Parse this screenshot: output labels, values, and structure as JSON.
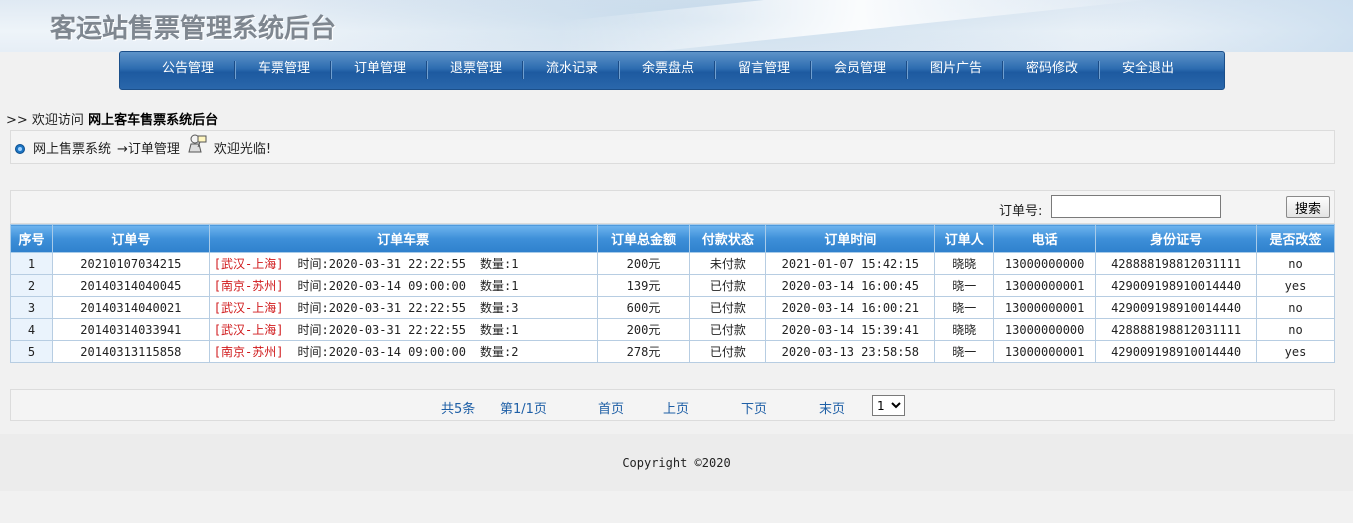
{
  "header": {
    "title": "客运站售票管理系统后台"
  },
  "nav": {
    "items": [
      {
        "label": "公告管理"
      },
      {
        "label": "车票管理"
      },
      {
        "label": "订单管理"
      },
      {
        "label": "退票管理"
      },
      {
        "label": "流水记录"
      },
      {
        "label": "余票盘点"
      },
      {
        "label": "留言管理"
      },
      {
        "label": "会员管理"
      },
      {
        "label": "图片广告"
      },
      {
        "label": "密码修改"
      },
      {
        "label": "安全退出"
      }
    ]
  },
  "welcome": {
    "prefix": ">>  欢迎访问",
    "site": "网上客车售票系统后台"
  },
  "breadcrumb": {
    "root": "网上售票系统",
    "current": "→订单管理",
    "greeting": "欢迎光临!"
  },
  "search": {
    "label": "订单号:",
    "value": "",
    "button": "搜索"
  },
  "table": {
    "headers": [
      "序号",
      "订单号",
      "订单车票",
      "订单总金额",
      "付款状态",
      "订单时间",
      "订单人",
      "电话",
      "身份证号",
      "是否改签"
    ],
    "rows": [
      {
        "idx": "1",
        "order_no": "20210107034215",
        "route": "[武汉-上海]",
        "time": "时间:2020-03-31 22:22:55",
        "qty": "数量:1",
        "amount": "200元",
        "status": "未付款",
        "order_time": "2021-01-07 15:42:15",
        "person": "晓晓",
        "phone": "13000000000",
        "id_no": "428888198812031111",
        "changed": "no"
      },
      {
        "idx": "2",
        "order_no": "20140314040045",
        "route": "[南京-苏州]",
        "time": "时间:2020-03-14 09:00:00",
        "qty": "数量:1",
        "amount": "139元",
        "status": "已付款",
        "order_time": "2020-03-14 16:00:45",
        "person": "晓一",
        "phone": "13000000001",
        "id_no": "429009198910014440",
        "changed": "yes"
      },
      {
        "idx": "3",
        "order_no": "20140314040021",
        "route": "[武汉-上海]",
        "time": "时间:2020-03-31 22:22:55",
        "qty": "数量:3",
        "amount": "600元",
        "status": "已付款",
        "order_time": "2020-03-14 16:00:21",
        "person": "晓一",
        "phone": "13000000001",
        "id_no": "429009198910014440",
        "changed": "no"
      },
      {
        "idx": "4",
        "order_no": "20140314033941",
        "route": "[武汉-上海]",
        "time": "时间:2020-03-31 22:22:55",
        "qty": "数量:1",
        "amount": "200元",
        "status": "已付款",
        "order_time": "2020-03-14 15:39:41",
        "person": "晓晓",
        "phone": "13000000000",
        "id_no": "428888198812031111",
        "changed": "no"
      },
      {
        "idx": "5",
        "order_no": "20140313115858",
        "route": "[南京-苏州]",
        "time": "时间:2020-03-14 09:00:00",
        "qty": "数量:2",
        "amount": "278元",
        "status": "已付款",
        "order_time": "2020-03-13 23:58:58",
        "person": "晓一",
        "phone": "13000000001",
        "id_no": "429009198910014440",
        "changed": "yes"
      }
    ]
  },
  "pager": {
    "total": "共5条",
    "page": "第1/1页",
    "first": "首页",
    "prev": "上页",
    "next": "下页",
    "last": "末页",
    "selected": "1"
  },
  "footer": {
    "copyright": "Copyright ©2020"
  },
  "colors": {
    "nav": "#2d6cb0",
    "table_header": "#3d8fd8",
    "route": "#d0191b",
    "link": "#1e5fa6"
  }
}
